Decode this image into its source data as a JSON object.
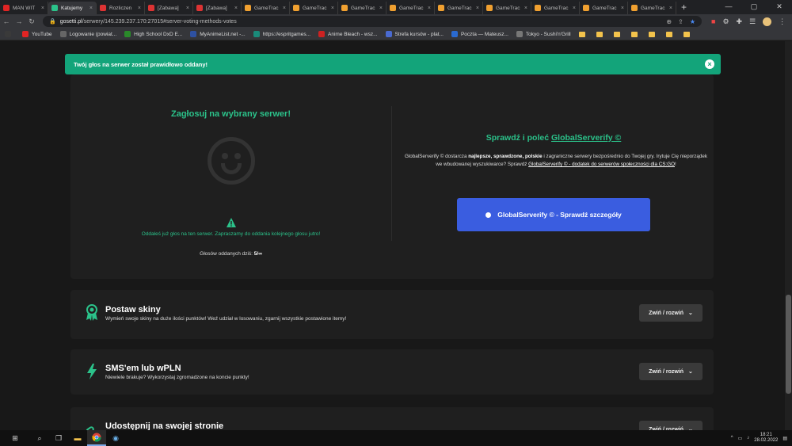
{
  "browser": {
    "tabs": [
      {
        "title": "MAN WIT",
        "icon": "youtube-icon",
        "color": "#e02424"
      },
      {
        "title": "Katujemy",
        "icon": "refresh-icon",
        "color": "#2bc28a",
        "active": true
      },
      {
        "title": "Rozliczen",
        "icon": "opera-icon",
        "color": "#d33"
      },
      {
        "title": "[Zabawa]",
        "icon": "opera-icon",
        "color": "#d33"
      },
      {
        "title": "[Zabawa]",
        "icon": "opera-icon",
        "color": "#d33"
      },
      {
        "title": "GameTrac",
        "icon": "gametracker-icon",
        "color": "#f0a030"
      },
      {
        "title": "GameTrac",
        "icon": "gametracker-icon",
        "color": "#f0a030"
      },
      {
        "title": "GameTrac",
        "icon": "gametracker-icon",
        "color": "#f0a030"
      },
      {
        "title": "GameTrac",
        "icon": "gametracker-icon",
        "color": "#f0a030"
      },
      {
        "title": "GameTrac",
        "icon": "gametracker-icon",
        "color": "#f0a030"
      },
      {
        "title": "GameTrac",
        "icon": "gametracker-icon",
        "color": "#f0a030"
      },
      {
        "title": "GameTrac",
        "icon": "gametracker-icon",
        "color": "#f0a030"
      },
      {
        "title": "GameTrac",
        "icon": "gametracker-icon",
        "color": "#f0a030"
      },
      {
        "title": "GameTrac",
        "icon": "gametracker-icon",
        "color": "#f0a030"
      }
    ],
    "new_tab": "+",
    "url_domain": "gosetti.pl",
    "url_path": "/serwery/145.239.237.170:27015#server-voting-methods-votes",
    "bookmarks": [
      {
        "label": "",
        "icon": "apps-icon",
        "color": "#3a3a3a"
      },
      {
        "label": "YouTube",
        "icon": "youtube-icon",
        "color": "#e02424"
      },
      {
        "label": "Logowanie (powiat...",
        "icon": "globe-icon",
        "color": "#666"
      },
      {
        "label": "High School DxD E...",
        "icon": "k-icon",
        "color": "#2a8a2a"
      },
      {
        "label": "MyAnimeList.net -...",
        "icon": "mal-icon",
        "color": "#2e51a2"
      },
      {
        "label": "https://espritgames...",
        "icon": "esprit-icon",
        "color": "#1a8a7a"
      },
      {
        "label": "Anime Bleach - wsz...",
        "icon": "anime-icon",
        "color": "#c22"
      },
      {
        "label": "Strefa kursów - plat...",
        "icon": "strefa-icon",
        "color": "#4a6ad0"
      },
      {
        "label": "Poczta — Mateusz...",
        "icon": "mail-icon",
        "color": "#2a6ad0"
      },
      {
        "label": "Tokyo - Sushi'n'Grill",
        "icon": "tokyo-icon",
        "color": "#777"
      }
    ]
  },
  "alert": {
    "message": "Twój głos na serwer został prawidłowo oddany!",
    "close": "×"
  },
  "vote": {
    "title": "Zagłosuj na wybrany serwer!",
    "warning": "Oddałeś już głos na ten serwer. Zapraszamy do oddania kolejnego głosu jutro!",
    "count_label": "Głosów oddanych dziś:",
    "count_value": "5/∞"
  },
  "serverify": {
    "title_prefix": "Sprawdź i poleć",
    "title_link": "GlobalServerify ©",
    "desc_1": "GlobalServerify © dostarcza",
    "desc_bold": "najlepsze, sprawdzone, polskie",
    "desc_2": "i zagraniczne serwery bezpośrednio do Twojej gry. Irytuje Cię nieporządek we wbudowanej wyszukiwarce? Sprawdź",
    "desc_link": "GlobalServerify © - dodatek do serwerów społeczności dla CS:GO",
    "desc_end": "!",
    "button": "GlobalServerify © - Sprawdź szczegóły"
  },
  "sections": [
    {
      "title": "Postaw skiny",
      "subtitle": "Wymień swoje skiny na duże ilości punktów! Weź udział w losowaniu, zgarnij wszystkie postawione itemy!",
      "toggle": "Zwiń / rozwiń",
      "icon": "award-icon"
    },
    {
      "title": "SMS'em lub wPLN",
      "subtitle": "Niewiele brakuje? Wykorzystaj zgromadzone na koncie punkty!",
      "toggle": "Zwiń / rozwiń",
      "icon": "lightning-icon"
    },
    {
      "title": "Udostępnij na swojej stronie",
      "subtitle": "",
      "toggle": "Zwiń / rozwiń",
      "icon": "link-icon"
    }
  ],
  "taskbar": {
    "time": "18:21",
    "date": "28.02.2022"
  },
  "colors": {
    "accent": "#2bc28a",
    "alert_bg": "#13a47a",
    "button_blue": "#3a5de0"
  }
}
